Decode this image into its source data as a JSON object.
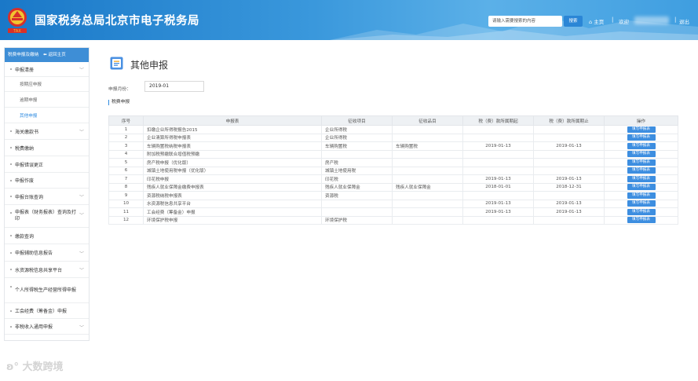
{
  "header": {
    "site_title": "国家税务总局北京市电子税务局",
    "logo_text": "TAX",
    "search_placeholder": "请输入需要搜索的内容",
    "search_button": "搜索",
    "home_link": "主页",
    "welcome": "欢迎",
    "logout": "退出"
  },
  "sidebar": {
    "head_label": "税费申报及缴纳",
    "back_label": "返回主页",
    "items": [
      {
        "label": "申报清册",
        "chev": "expanded",
        "subs": [
          {
            "label": "按期应申报",
            "active": false
          },
          {
            "label": "逾期申报",
            "active": false
          },
          {
            "label": "其他申报",
            "active": true
          }
        ]
      },
      {
        "label": "海关缴款书",
        "chev": "collapsed"
      },
      {
        "label": "税费缴纳",
        "chev": "none"
      },
      {
        "label": "申报错误更正",
        "chev": "none"
      },
      {
        "label": "申报作废",
        "chev": "none"
      },
      {
        "label": "申报台账查询",
        "chev": "collapsed"
      },
      {
        "label": "申报表（财务报表）查询及打印",
        "chev": "collapsed"
      },
      {
        "label": "缴款查询",
        "chev": "none"
      },
      {
        "label": "申报辅助信息报告",
        "chev": "collapsed"
      },
      {
        "label": "水资源税信息共享平台",
        "chev": "collapsed"
      },
      {
        "label": "个人所得税生产经营所得申报",
        "chev": "none"
      },
      {
        "label": "工会经费（筹备金）申报",
        "chev": "none"
      },
      {
        "label": "非税收入通用申报",
        "chev": "collapsed"
      }
    ]
  },
  "main": {
    "title": "其他申报",
    "month_label": "申报月份：",
    "month_value": "2019-01",
    "section_title": "税费申报",
    "columns": [
      "序号",
      "申报表",
      "征收项目",
      "征收品目",
      "税（费）款所属期起",
      "税（费）款所属期止",
      "操作"
    ],
    "action_label": "填写申报表",
    "rows": [
      {
        "no": "1",
        "form": "扣缴企业所得税报告2015",
        "item": "企业所得税",
        "sub": "",
        "from": "",
        "to": ""
      },
      {
        "no": "2",
        "form": "企业清算所得税申报表",
        "item": "企业所得税",
        "sub": "",
        "from": "",
        "to": ""
      },
      {
        "no": "3",
        "form": "车辆购置税纳税申报表",
        "item": "车辆购置税",
        "sub": "车辆购置税",
        "from": "2019-01-13",
        "to": "2019-01-13"
      },
      {
        "no": "4",
        "form": "附加税预缴联合增值税预缴",
        "item": "",
        "sub": "",
        "from": "",
        "to": ""
      },
      {
        "no": "5",
        "form": "房产税申报（优化版）",
        "item": "房产税",
        "sub": "",
        "from": "",
        "to": ""
      },
      {
        "no": "6",
        "form": "城镇土地使用税申报（优化版）",
        "item": "城镇土地使用税",
        "sub": "",
        "from": "",
        "to": ""
      },
      {
        "no": "7",
        "form": "印花税申报",
        "item": "印花税",
        "sub": "",
        "from": "2019-01-13",
        "to": "2019-01-13"
      },
      {
        "no": "8",
        "form": "残疾人就业保障金缴费申报表",
        "item": "残疾人就业保障金",
        "sub": "残疾人就业保障金",
        "from": "2018-01-01",
        "to": "2018-12-31"
      },
      {
        "no": "9",
        "form": "资源税纳税申报表",
        "item": "资源税",
        "sub": "",
        "from": "",
        "to": ""
      },
      {
        "no": "10",
        "form": "水资源税信息共享平台",
        "item": "",
        "sub": "",
        "from": "2019-01-13",
        "to": "2019-01-13"
      },
      {
        "no": "11",
        "form": "工会经费（筹备金）申报",
        "item": "",
        "sub": "",
        "from": "2019-01-13",
        "to": "2019-01-13"
      },
      {
        "no": "12",
        "form": "环境保护税申报",
        "item": "环境保护税",
        "sub": "",
        "from": "",
        "to": ""
      }
    ]
  },
  "watermark": "大数跨境",
  "colors": {
    "header_blue": "#1a78c8",
    "accent_blue": "#3d8ee0",
    "sidebar_head": "#3e8ed6",
    "active_link": "#2f8be0"
  }
}
